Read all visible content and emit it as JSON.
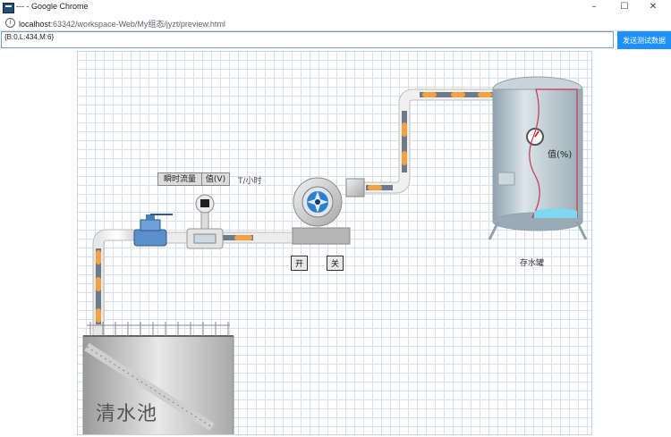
{
  "window": {
    "title": "--- - Google Chrome",
    "minimize": "–",
    "maximize": "☐",
    "close": "✕"
  },
  "address_bar": {
    "host": "localhost",
    "path": ":63342/workspace-Web/My组态/jyzt/preview.html"
  },
  "command": {
    "value": "{B:0,L:434,M:6}"
  },
  "send_button": {
    "label": "发送测试数据"
  },
  "flowmeter": {
    "label": "瞬时流量",
    "value": "值(V)",
    "unit": "T/小时"
  },
  "pump_controls": {
    "on_label": "开",
    "off_label": "关"
  },
  "storage_tank": {
    "value": "值(%)",
    "label": "存水罐"
  },
  "pool": {
    "label": "清水池"
  },
  "colors": {
    "accent": "#1e90ff",
    "pipe_fill": "#6e7a8a",
    "pipe_segment": "#f2a341",
    "tank_body": "#b9c6cf",
    "water_outline": "#cc3355",
    "water": "#7fd8f0",
    "pump_blue": "#2f7fd0"
  }
}
